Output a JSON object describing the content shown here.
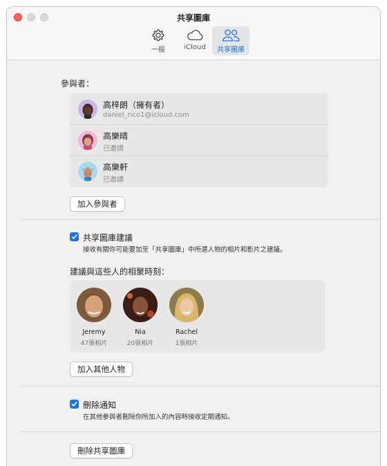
{
  "window": {
    "title": "共享圖庫"
  },
  "tabs": [
    {
      "label": "一般",
      "icon": "gear-icon"
    },
    {
      "label": "iCloud",
      "icon": "cloud-icon"
    },
    {
      "label": "共享圖庫",
      "icon": "people-icon",
      "active": true
    }
  ],
  "participants": {
    "heading": "參與者：",
    "people": [
      {
        "name": "高梓朗（擁有者）",
        "detail": "daniel_rico1@icloud.com"
      },
      {
        "name": "高樂晴",
        "detail": "已邀請"
      },
      {
        "name": "高樂軒",
        "detail": "已邀請"
      }
    ],
    "add_button": "加入參與者"
  },
  "suggestions": {
    "checkbox_label": "共享圖庫建議",
    "checked": true,
    "description": "接收有關你可能要加至「共享圖庫」中所選人物的相片和影片之建議。",
    "moments_heading": "建議與這些人的相聚時刻：",
    "people": [
      {
        "name": "Jeremy",
        "count": "47張相片"
      },
      {
        "name": "Nia",
        "count": "20張相片"
      },
      {
        "name": "Rachel",
        "count": "1張相片"
      }
    ],
    "add_button": "加入其他人物"
  },
  "deletion": {
    "checkbox_label": "刪除通知",
    "checked": true,
    "description": "在其他參與者刪除你所加入的內容時接收定期通知。"
  },
  "delete_library_button": "刪除共享圖庫",
  "colors": {
    "accent": "#1a73e8",
    "close": "#ff5f57"
  }
}
